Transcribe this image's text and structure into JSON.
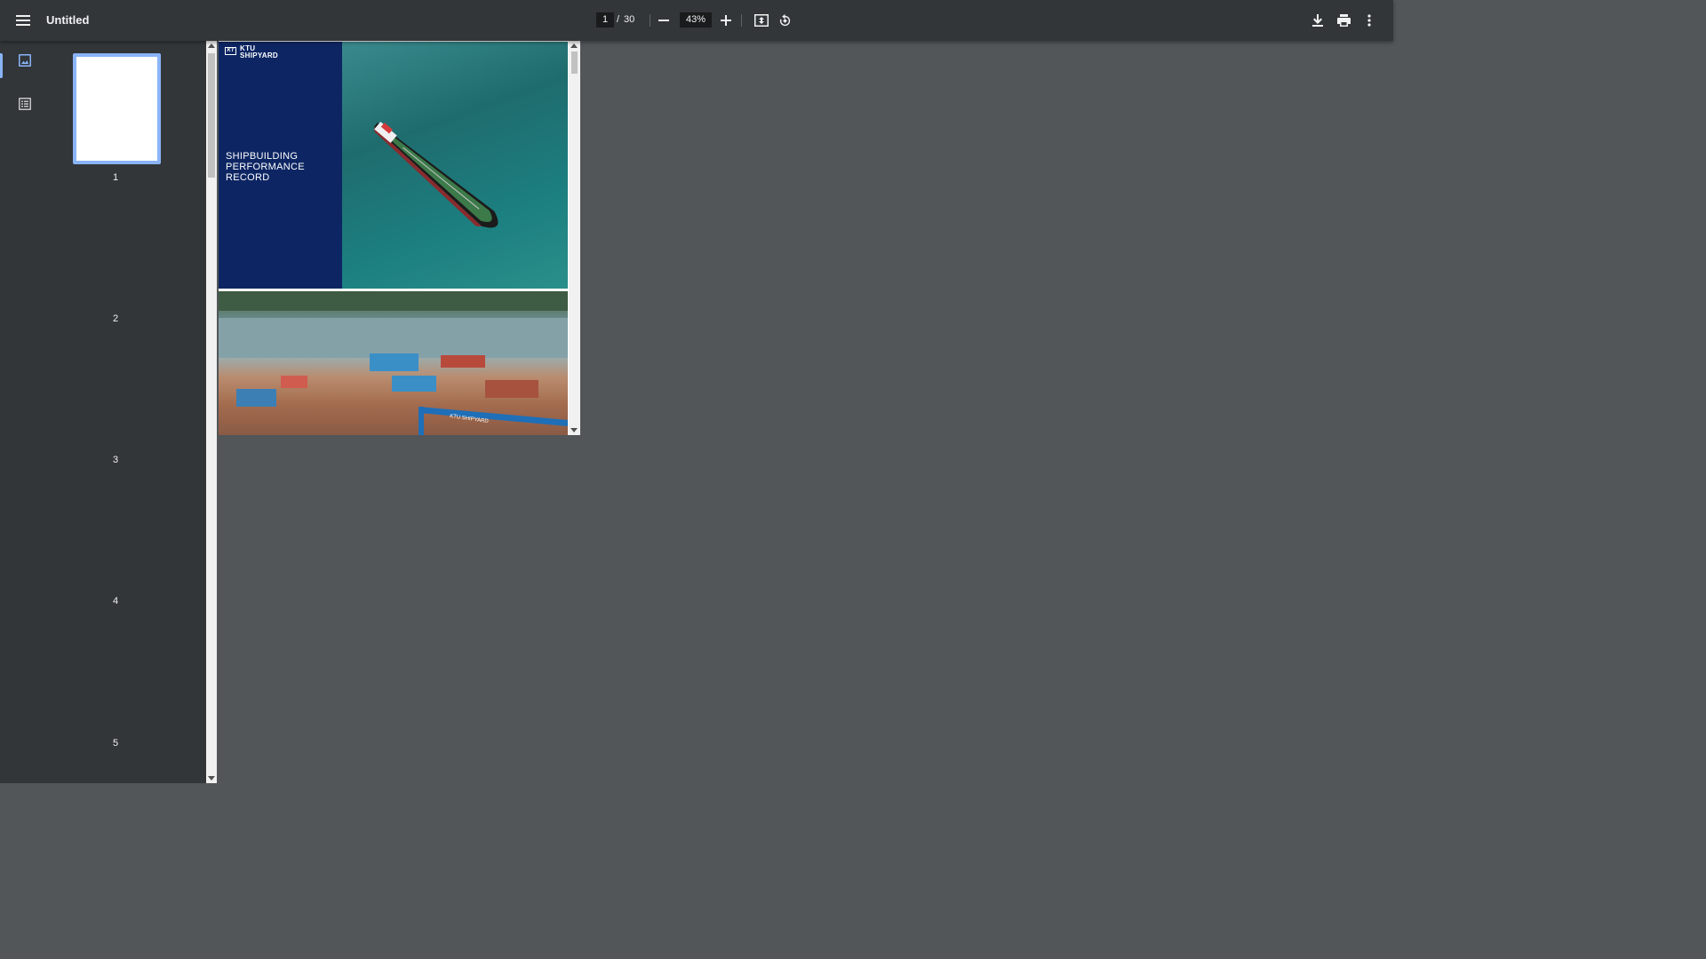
{
  "toolbar": {
    "title": "Untitled",
    "page_current": "1",
    "page_separator": "/",
    "page_total": "30",
    "zoom": "43%",
    "icons": [
      "menu-icon",
      "zoom-out-icon",
      "zoom-in-icon",
      "fit-page-icon",
      "rotate-icon",
      "download-icon",
      "print-icon",
      "more-icon"
    ]
  },
  "sidebar": {
    "tabs": [
      {
        "name": "thumbnails",
        "icon": "image-icon",
        "active": true
      },
      {
        "name": "outline",
        "icon": "list-icon",
        "active": false
      }
    ],
    "thumbnails": [
      {
        "label": "1",
        "selected": true
      },
      {
        "label": "2",
        "selected": false
      },
      {
        "label": "3",
        "selected": false
      },
      {
        "label": "4",
        "selected": false
      },
      {
        "label": "5",
        "selected": false
      }
    ]
  },
  "document": {
    "cover": {
      "logo_mark": "KT",
      "logo_line1": "KTU",
      "logo_line2": "SHIPYARD",
      "title_lines": [
        "SHIPBUILDING",
        "PERFORMANCE",
        "RECORD"
      ],
      "panel_color": "#0d2663"
    },
    "page2_label": "KTU SHIPYARD"
  },
  "colors": {
    "toolbar_bg": "#323639",
    "viewer_bg": "#525659",
    "accent": "#8ab4f8"
  }
}
